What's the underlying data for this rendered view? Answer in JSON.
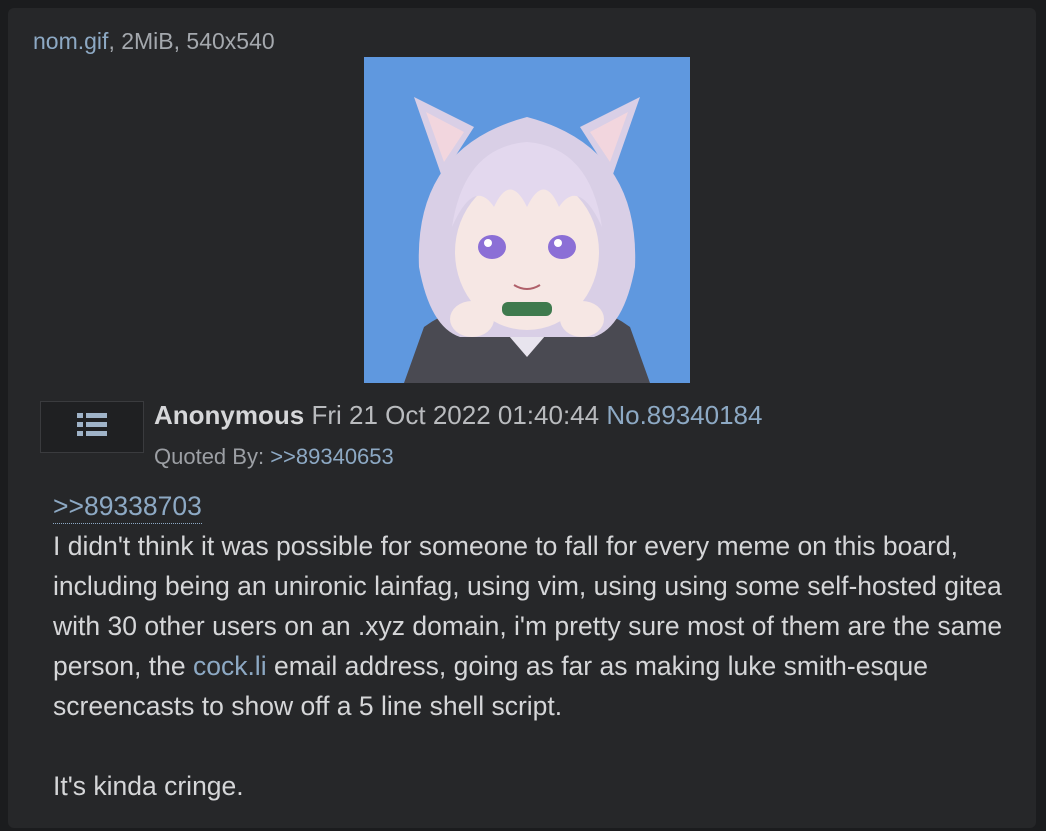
{
  "file": {
    "name": "nom.gif",
    "meta": ", 2MiB, 540x540"
  },
  "post": {
    "name": "Anonymous",
    "date": "Fri 21 Oct 2022 01:40:44",
    "number": "No.89340184",
    "quoted_by_label": "Quoted By: ",
    "quoted_by_link": ">>89340653",
    "reply_to": ">>89338703",
    "body_before_link": "I didn't think it was possible for someone to fall for every meme on this board, including being an unironic lainfag, using vim, using using some self-hosted gitea with 30 other users on an .xyz domain, i'm pretty sure most of them are the same person, the ",
    "body_link": "cock.li",
    "body_after_link": " email address, going as far as making luke smith-esque screencasts to show off a 5 line shell script.",
    "closing": "It's kinda cringe."
  },
  "icons": {
    "menu": "list-menu-icon"
  },
  "colors": {
    "background": "#1b1c1e",
    "post_background": "#262729",
    "link": "#8da9c4",
    "text": "#d5d6d8",
    "thumbnail_background": "#5f98df"
  }
}
